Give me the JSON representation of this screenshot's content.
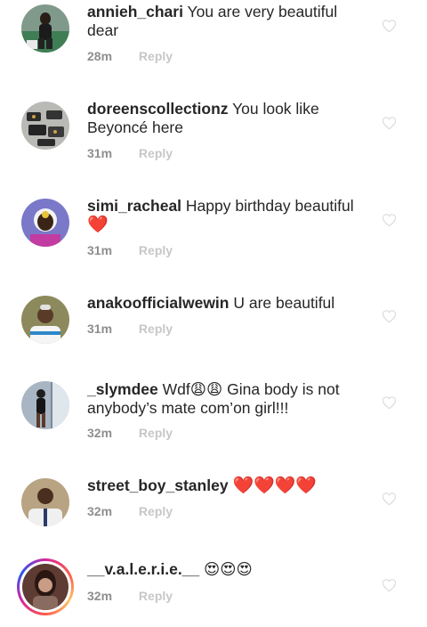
{
  "comments": [
    {
      "username": "annieh_chari",
      "text": "You are very beautiful dear",
      "time": "28m",
      "reply": "Reply"
    },
    {
      "username": "doreenscollectionz",
      "text": "You look like Beyoncé here",
      "time": "31m",
      "reply": "Reply"
    },
    {
      "username": "simi_racheal",
      "text": "Happy birthday beautiful",
      "emoji": "❤️",
      "time": "31m",
      "reply": "Reply"
    },
    {
      "username": "anakoofficialwewin",
      "text": "U are beautiful",
      "time": "31m",
      "reply": "Reply"
    },
    {
      "username": "_slymdee",
      "text": "Wdf😩😩 Gina body is not anybody’s mate com’on girl!!!",
      "time": "32m",
      "reply": "Reply"
    },
    {
      "username": "street_boy_stanley",
      "text": "❤️❤️❤️❤️",
      "time": "32m",
      "reply": "Reply"
    },
    {
      "username": "__v.a.l.e.r.i.e.__",
      "text": "😍😍😍",
      "time": "32m",
      "reply": "Reply"
    }
  ],
  "colors": {
    "text": "#262626",
    "meta": "#8e8e8e",
    "reply": "#c7c7c7",
    "heart_outline": "#dbdbdb",
    "emoji_heart": "#e0242e"
  },
  "icons": {
    "like": "heart-outline-icon"
  }
}
